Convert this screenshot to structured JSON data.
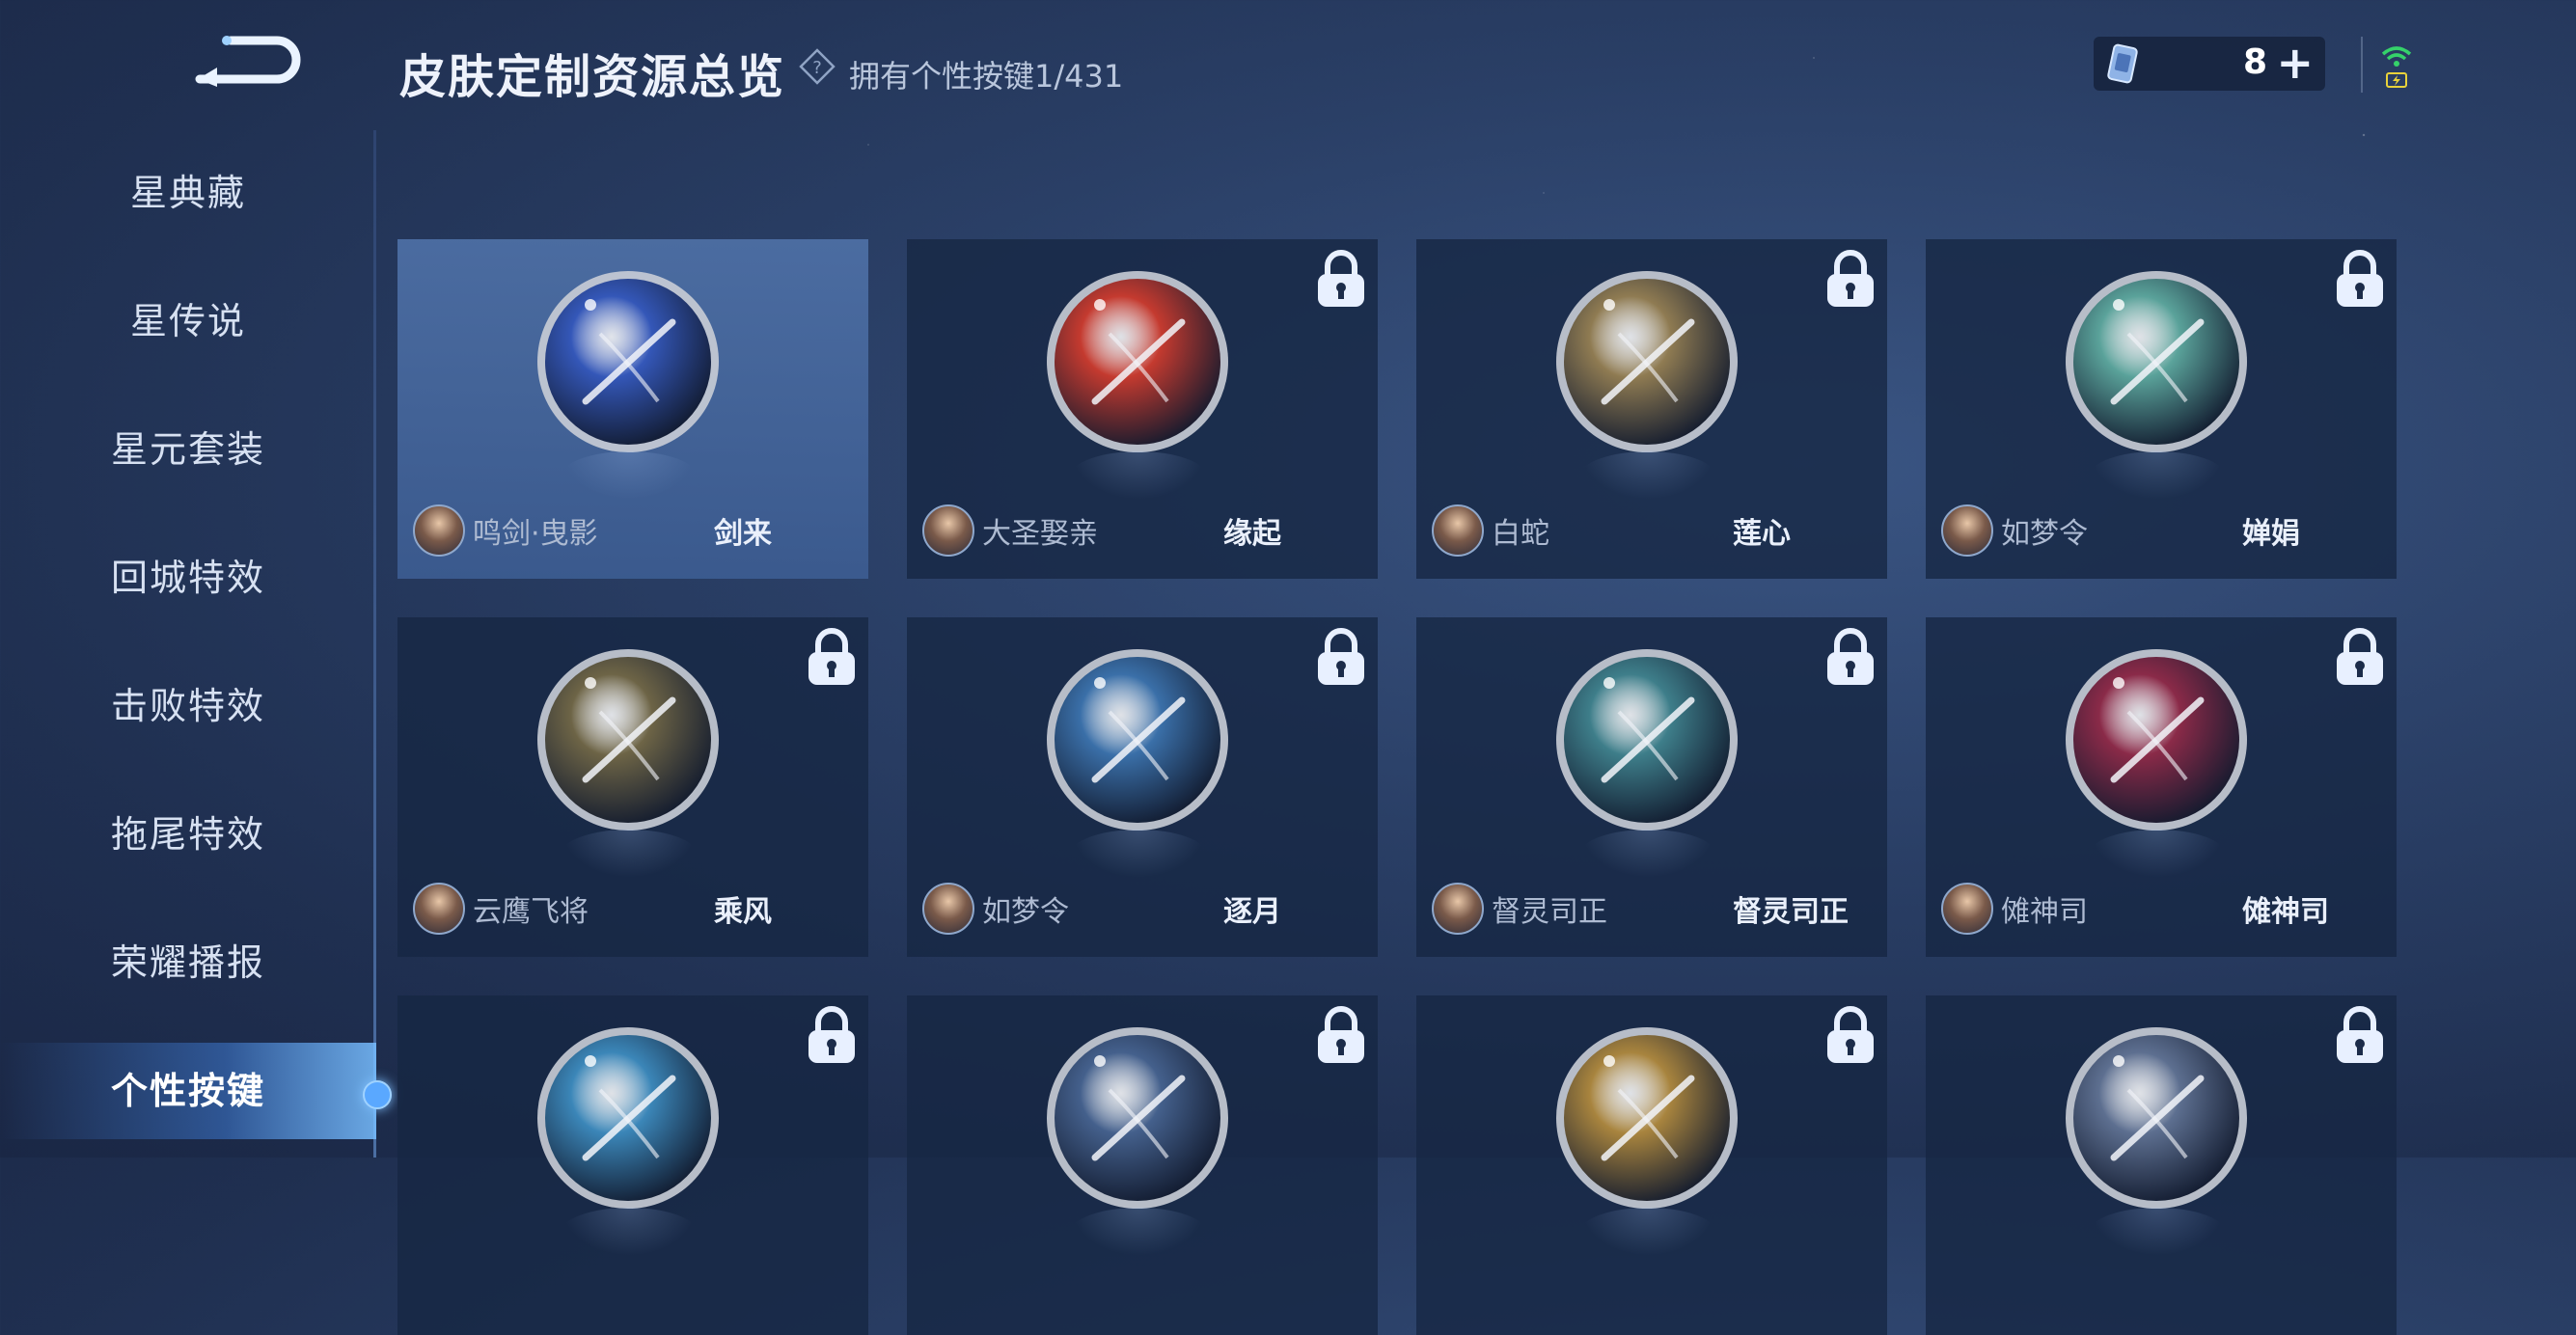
{
  "header": {
    "title": "皮肤定制资源总览",
    "owned_label": "拥有个性按键",
    "owned_count": "1/431"
  },
  "currency": {
    "amount": "8",
    "plus": "+"
  },
  "sidebar": {
    "items": [
      {
        "label": "星典藏"
      },
      {
        "label": "星传说"
      },
      {
        "label": "星元套装"
      },
      {
        "label": "回城特效"
      },
      {
        "label": "击败特效"
      },
      {
        "label": "拖尾特效"
      },
      {
        "label": "荣耀播报"
      },
      {
        "label": "个性按键",
        "active": true
      }
    ]
  },
  "grid": {
    "cards": [
      {
        "hero": "鸣剑·曳影",
        "skin": "剑来",
        "locked": false,
        "selected": true,
        "icon": "sword-clock-icon",
        "color": "#3457b8"
      },
      {
        "hero": "大圣娶亲",
        "skin": "缘起",
        "locked": true,
        "icon": "scroll-icon",
        "color": "#c43a2f"
      },
      {
        "hero": "白蛇",
        "skin": "莲心",
        "locked": true,
        "icon": "lotus-icon",
        "color": "#8f7b52"
      },
      {
        "hero": "如梦令",
        "skin": "婵娟",
        "locked": true,
        "icon": "moon-mirror-icon",
        "color": "#5aa29a"
      },
      {
        "hero": "云鹰飞将",
        "skin": "乘风",
        "locked": true,
        "icon": "spear-icon",
        "color": "#6d6446"
      },
      {
        "hero": "如梦令",
        "skin": "逐月",
        "locked": true,
        "icon": "wing-icon",
        "color": "#3a6fa8"
      },
      {
        "hero": "督灵司正",
        "skin": "督灵司正",
        "locked": true,
        "icon": "dragon-icon",
        "color": "#3e7e8a"
      },
      {
        "hero": "傩神司",
        "skin": "傩神司",
        "locked": true,
        "icon": "crystal-icon",
        "color": "#8a2a48"
      },
      {
        "hero": "",
        "skin": "",
        "locked": true,
        "icon": "blade-icon",
        "color": "#3b86b8"
      },
      {
        "hero": "",
        "skin": "",
        "locked": true,
        "icon": "star-icon",
        "color": "#44608c"
      },
      {
        "hero": "",
        "skin": "",
        "locked": true,
        "icon": "sun-emblem-icon",
        "color": "#a8843e"
      },
      {
        "hero": "",
        "skin": "",
        "locked": true,
        "icon": "star-icon",
        "color": "#5d6f90"
      }
    ]
  }
}
